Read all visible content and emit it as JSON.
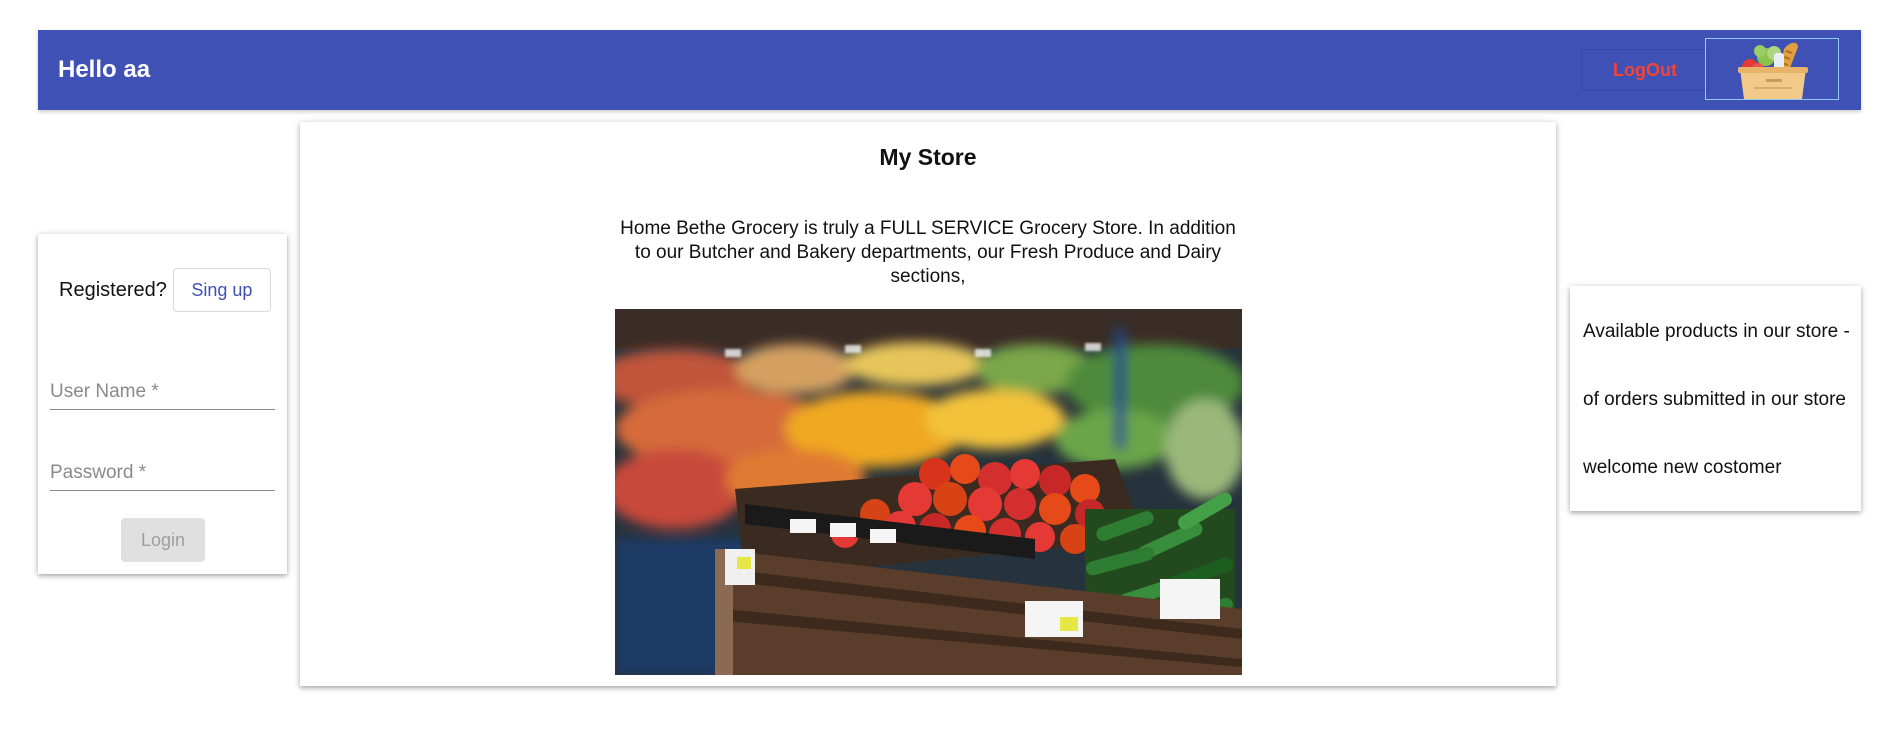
{
  "header": {
    "title": "Hello aa",
    "logout_label": "LogOut",
    "logo": "grocery-basket-logo"
  },
  "login": {
    "registered_label": "Registered?",
    "signup_label": "Sing up",
    "username_placeholder": "User Name *",
    "password_placeholder": "Password *",
    "login_label": "Login"
  },
  "store": {
    "title": "My Store",
    "description": "Home Bethe Grocery is truly a FULL SERVICE Grocery Store. In addition to our Butcher and Bakery departments, our Fresh Produce and Dairy sections,",
    "image": "produce-display-photo"
  },
  "info": {
    "available_products": "Available products in our store -",
    "orders_submitted": "of orders submitted in our store",
    "welcome": "welcome new costomer"
  },
  "colors": {
    "appbar": "#3f51b5",
    "logout": "#f44336",
    "signup": "#3f51b5"
  }
}
